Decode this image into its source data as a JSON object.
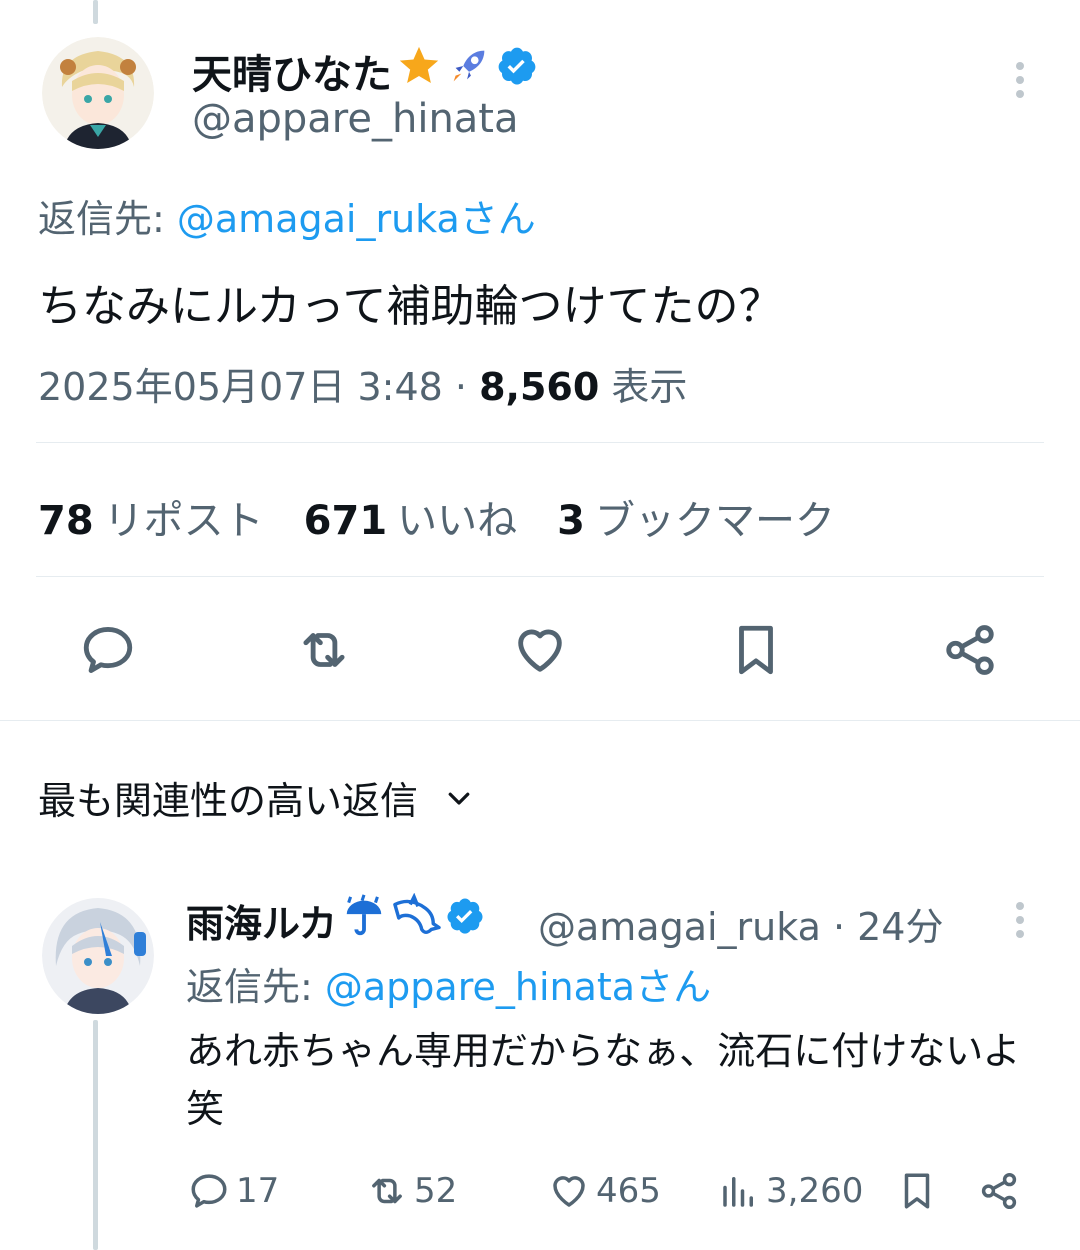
{
  "main_tweet": {
    "display_name": "天晴ひなた",
    "handle": "@appare_hinata",
    "reply_to_prefix": "返信先: ",
    "reply_to_user": "@amagai_rukaさん",
    "text": "ちなみにルカって補助輪つけてたの？",
    "date": "2025年05月07日 3:48",
    "separator": " · ",
    "views": "8,560",
    "views_label": " 表示",
    "stats": {
      "reposts_count": "78",
      "reposts_label": "リポスト",
      "likes_count": "671",
      "likes_label": "いいね",
      "bookmarks_count": "3",
      "bookmarks_label": "ブックマーク"
    }
  },
  "sort": {
    "label": "最も関連性の高い返信"
  },
  "reply": {
    "display_name": "雨海ルカ",
    "handle_time": "@amagai_ruka · 24分",
    "reply_to_prefix": "返信先: ",
    "reply_to_user": "@appare_hinataさん",
    "text": "あれ赤ちゃん専用だからなぁ、流石に付けないよ笑",
    "replies": "17",
    "reposts": "52",
    "likes": "465",
    "views": "3,260"
  },
  "colors": {
    "accent": "#1d9bf0",
    "text": "#0f1419",
    "secondary": "#536471",
    "divider": "#e6ecf0"
  }
}
